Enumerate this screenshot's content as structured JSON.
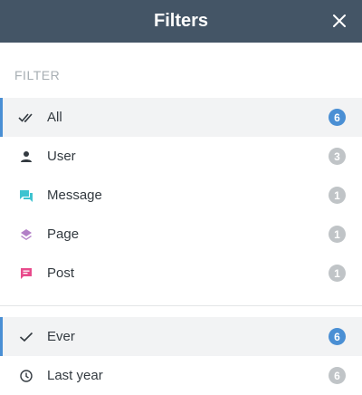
{
  "header": {
    "title": "Filters"
  },
  "filter_section": {
    "label": "FILTER",
    "items": [
      {
        "label": "All",
        "count": "6",
        "icon": "double-check-icon",
        "active": true
      },
      {
        "label": "User",
        "count": "3",
        "icon": "user-icon",
        "active": false
      },
      {
        "label": "Message",
        "count": "1",
        "icon": "message-icon",
        "active": false
      },
      {
        "label": "Page",
        "count": "1",
        "icon": "layers-icon",
        "active": false
      },
      {
        "label": "Post",
        "count": "1",
        "icon": "comment-icon",
        "active": false
      }
    ]
  },
  "time_section": {
    "items": [
      {
        "label": "Ever",
        "count": "6",
        "icon": "check-icon",
        "active": true
      },
      {
        "label": "Last year",
        "count": "6",
        "icon": "clock-icon",
        "active": false
      }
    ]
  },
  "colors": {
    "header_bg": "#445566",
    "accent": "#4a8fd4",
    "badge_inactive": "#c0c4c7",
    "message_icon": "#3ec3d0",
    "page_icon": "#b27fc7",
    "post_icon": "#e84b8c"
  }
}
